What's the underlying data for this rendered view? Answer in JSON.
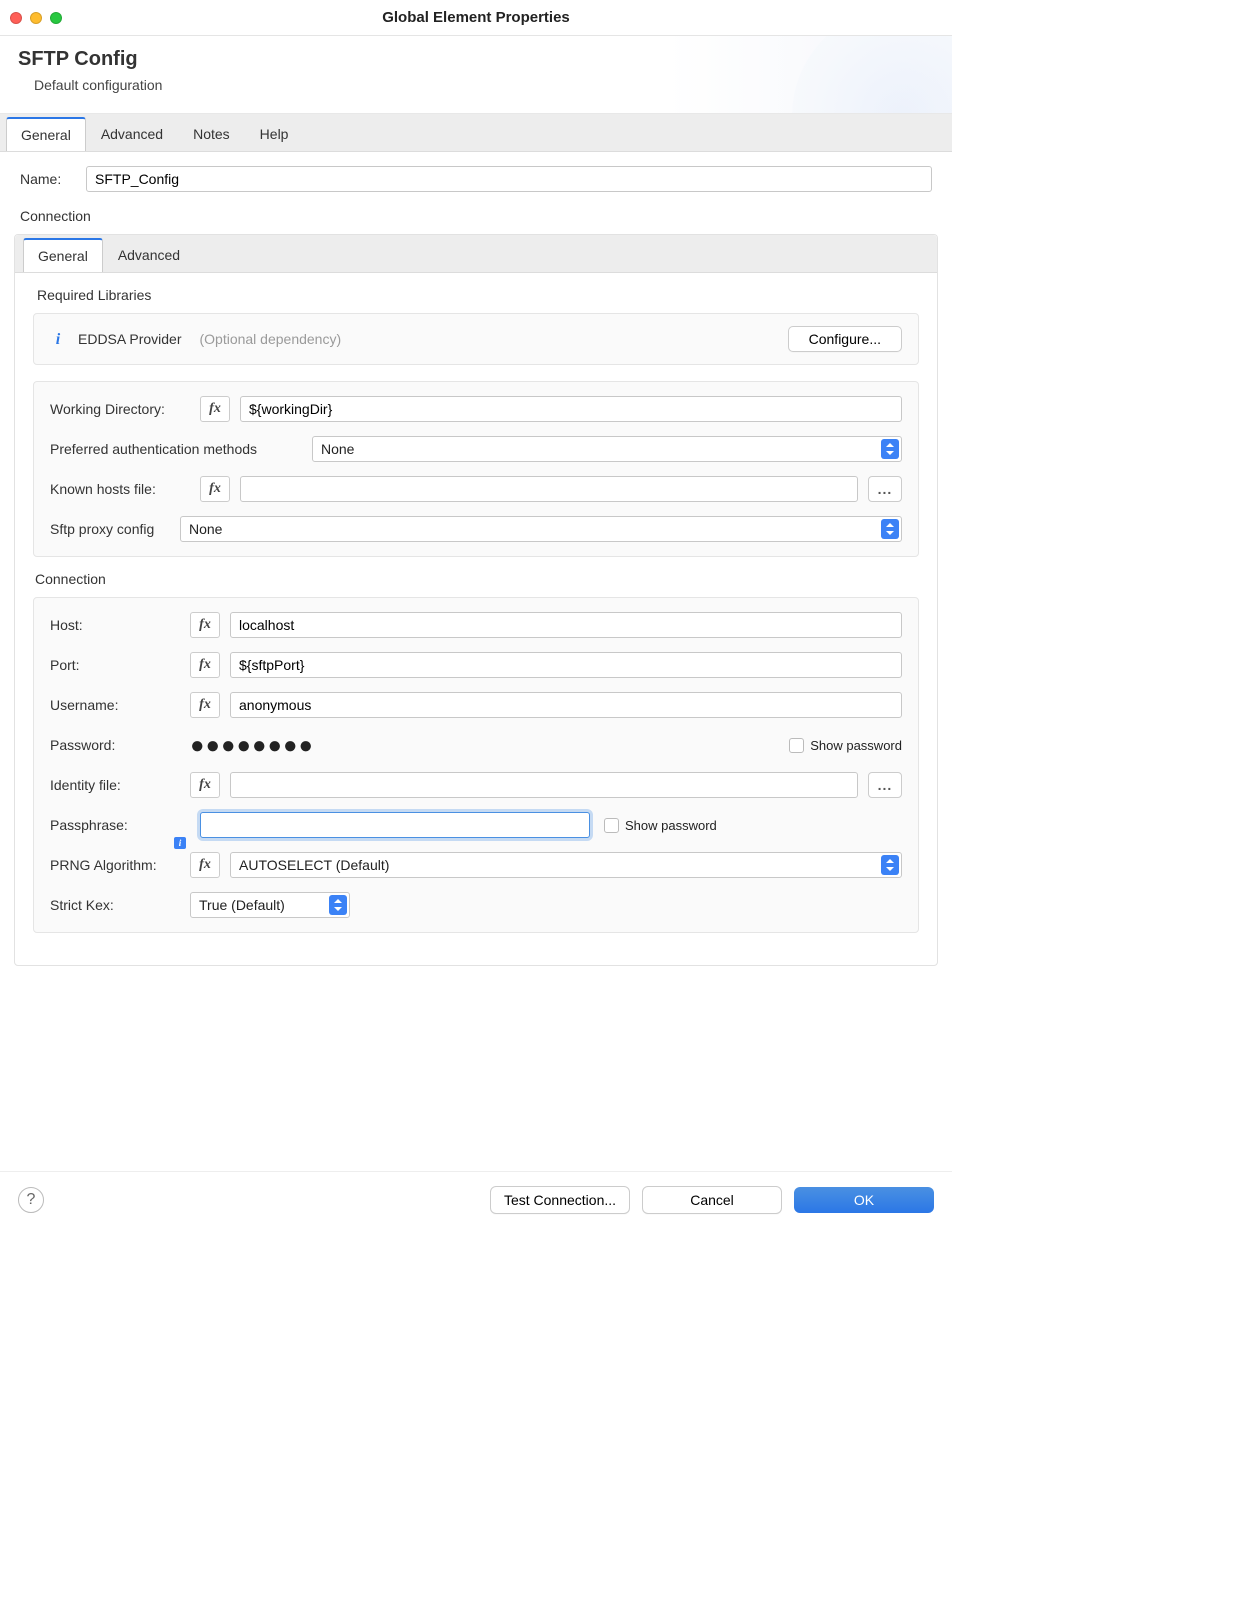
{
  "window": {
    "title": "Global Element Properties"
  },
  "header": {
    "title": "SFTP Config",
    "subtitle": "Default configuration"
  },
  "outerTabs": [
    {
      "label": "General",
      "active": true
    },
    {
      "label": "Advanced",
      "active": false
    },
    {
      "label": "Notes",
      "active": false
    },
    {
      "label": "Help",
      "active": false
    }
  ],
  "nameField": {
    "label": "Name:",
    "value": "SFTP_Config"
  },
  "connectionLabel": "Connection",
  "innerTabs": [
    {
      "label": "General",
      "active": true
    },
    {
      "label": "Advanced",
      "active": false
    }
  ],
  "requiredLibraries": {
    "title": "Required Libraries",
    "item": {
      "name": "EDDSA Provider",
      "hint": "(Optional dependency)",
      "button": "Configure..."
    }
  },
  "generalFields": {
    "workingDirectory": {
      "label": "Working Directory:",
      "value": "${workingDir}"
    },
    "prefAuthMethods": {
      "label": "Preferred authentication methods",
      "value": "None"
    },
    "knownHostsFile": {
      "label": "Known hosts file:",
      "value": "",
      "browse": "..."
    },
    "sftpProxyConfig": {
      "label": "Sftp proxy config",
      "value": "None"
    }
  },
  "connectionSection": {
    "title": "Connection",
    "host": {
      "label": "Host:",
      "value": "localhost"
    },
    "port": {
      "label": "Port:",
      "value": "${sftpPort}"
    },
    "username": {
      "label": "Username:",
      "value": "anonymous"
    },
    "password": {
      "label": "Password:",
      "masked": "●●●●●●●●",
      "showLabel": "Show password"
    },
    "identityFile": {
      "label": "Identity file:",
      "value": "",
      "browse": "..."
    },
    "passphrase": {
      "label": "Passphrase:",
      "value": "",
      "showLabel": "Show password"
    },
    "prngAlgorithm": {
      "label": "PRNG Algorithm:",
      "value": "AUTOSELECT (Default)"
    },
    "strictKex": {
      "label": "Strict Kex:",
      "value": "True (Default)"
    }
  },
  "footer": {
    "test": "Test Connection...",
    "cancel": "Cancel",
    "ok": "OK"
  },
  "fx": "fx"
}
